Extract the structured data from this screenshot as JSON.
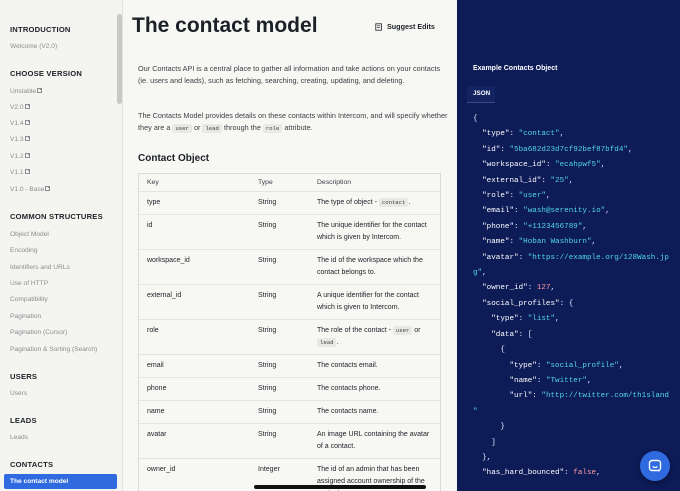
{
  "sidebar": {
    "sections": [
      {
        "title": "INTRODUCTION",
        "items": [
          {
            "label": "Welcome (V2.0)",
            "ext": false
          }
        ]
      },
      {
        "title": "CHOOSE VERSION",
        "items": [
          {
            "label": "Unstable",
            "ext": true
          },
          {
            "label": "V2.0",
            "ext": true
          },
          {
            "label": "V1.4",
            "ext": true
          },
          {
            "label": "V1.3",
            "ext": true
          },
          {
            "label": "V1.2",
            "ext": true
          },
          {
            "label": "V1.1",
            "ext": true
          },
          {
            "label": "V1.0 - Base",
            "ext": true
          }
        ]
      },
      {
        "title": "COMMON STRUCTURES",
        "items": [
          {
            "label": "Object Model",
            "ext": false
          },
          {
            "label": "Encoding",
            "ext": false
          },
          {
            "label": "Identifiers and URLs",
            "ext": false
          },
          {
            "label": "Use of HTTP",
            "ext": false
          },
          {
            "label": "Compatibility",
            "ext": false
          },
          {
            "label": "Pagination",
            "ext": false
          },
          {
            "label": "Pagination (Cursor)",
            "ext": false
          },
          {
            "label": "Pagination & Sorting (Search)",
            "ext": false
          }
        ]
      },
      {
        "title": "USERS",
        "items": [
          {
            "label": "Users",
            "ext": false
          }
        ]
      },
      {
        "title": "LEADS",
        "items": [
          {
            "label": "Leads",
            "ext": false
          }
        ]
      },
      {
        "title": "CONTACTS",
        "items": []
      }
    ],
    "active_item": "The contact model"
  },
  "main": {
    "title": "The contact model",
    "suggest_edits": "Suggest Edits",
    "intro": "Our Contacts API is a central place to gather all information and take actions on your contacts (ie. users and leads), such as fetching, searching, creating, updating, and deleting.",
    "para2_a": "The Contacts Model provides details on these contacts within Intercom, and will specify whether they are a",
    "para2_code1": "user",
    "para2_or": "or",
    "para2_code2": "lead",
    "para2_b": "through the",
    "para2_code3": "role",
    "para2_c": "attribute.",
    "object_title": "Contact Object",
    "table": {
      "headers": [
        "Key",
        "Type",
        "Description"
      ],
      "rows": [
        {
          "key": "type",
          "type": "String",
          "desc": "The type of object - ",
          "code": "contact",
          "desc_after": "."
        },
        {
          "key": "id",
          "type": "String",
          "desc": "The unique identifier for the contact which is given by Intercom."
        },
        {
          "key": "workspace_id",
          "type": "String",
          "desc": "The id of the workspace which the contact belongs to."
        },
        {
          "key": "external_id",
          "type": "String",
          "desc": "A unique identifier for the contact which is given to Intercom."
        },
        {
          "key": "role",
          "type": "String",
          "desc": "The role of the contact - ",
          "code": "user",
          "desc_mid": " or ",
          "code2": "lead",
          "desc_after": "."
        },
        {
          "key": "email",
          "type": "String",
          "desc": "The contacts email."
        },
        {
          "key": "phone",
          "type": "String",
          "desc": "The contacts phone."
        },
        {
          "key": "name",
          "type": "String",
          "desc": "The contacts name."
        },
        {
          "key": "avatar",
          "type": "String",
          "desc": "An image URL containing the avatar of a contact."
        },
        {
          "key": "owner_id",
          "type": "Integer",
          "desc": "The id of an admin that has been assigned account ownership of the contact."
        }
      ]
    }
  },
  "code_panel": {
    "title": "Example Contacts Object",
    "tab": "JSON",
    "lines": [
      [
        [
          "p",
          "{"
        ]
      ],
      [
        [
          "p",
          "  "
        ],
        [
          "k",
          "\"type\""
        ],
        [
          "p",
          ": "
        ],
        [
          "s",
          "\"contact\""
        ],
        [
          "p",
          ","
        ]
      ],
      [
        [
          "p",
          "  "
        ],
        [
          "k",
          "\"id\""
        ],
        [
          "p",
          ": "
        ],
        [
          "s",
          "\"5ba682d23d7cf92bef87bfd4\""
        ],
        [
          "p",
          ","
        ]
      ],
      [
        [
          "p",
          "  "
        ],
        [
          "k",
          "\"workspace_id\""
        ],
        [
          "p",
          ": "
        ],
        [
          "s",
          "\"ecahpwf5\""
        ],
        [
          "p",
          ","
        ]
      ],
      [
        [
          "p",
          "  "
        ],
        [
          "k",
          "\"external_id\""
        ],
        [
          "p",
          ": "
        ],
        [
          "s",
          "\"25\""
        ],
        [
          "p",
          ","
        ]
      ],
      [
        [
          "p",
          "  "
        ],
        [
          "k",
          "\"role\""
        ],
        [
          "p",
          ": "
        ],
        [
          "s",
          "\"user\""
        ],
        [
          "p",
          ","
        ]
      ],
      [
        [
          "p",
          "  "
        ],
        [
          "k",
          "\"email\""
        ],
        [
          "p",
          ": "
        ],
        [
          "s",
          "\"wash@serenity.io\""
        ],
        [
          "p",
          ","
        ]
      ],
      [
        [
          "p",
          "  "
        ],
        [
          "k",
          "\"phone\""
        ],
        [
          "p",
          ": "
        ],
        [
          "s",
          "\"+1123456789\""
        ],
        [
          "p",
          ","
        ]
      ],
      [
        [
          "p",
          "  "
        ],
        [
          "k",
          "\"name\""
        ],
        [
          "p",
          ": "
        ],
        [
          "s",
          "\"Hoban Washburn\""
        ],
        [
          "p",
          ","
        ]
      ],
      [
        [
          "p",
          "  "
        ],
        [
          "k",
          "\"avatar\""
        ],
        [
          "p",
          ": "
        ],
        [
          "s",
          "\"https://example.org/128Wash.jp"
        ]
      ],
      [
        [
          "s",
          "g\""
        ],
        [
          "p",
          ","
        ]
      ],
      [
        [
          "p",
          "  "
        ],
        [
          "k",
          "\"owner_id\""
        ],
        [
          "p",
          ": "
        ],
        [
          "n",
          "127"
        ],
        [
          "p",
          ","
        ]
      ],
      [
        [
          "p",
          "  "
        ],
        [
          "k",
          "\"social_profiles\""
        ],
        [
          "p",
          ": {"
        ]
      ],
      [
        [
          "p",
          "    "
        ],
        [
          "k",
          "\"type\""
        ],
        [
          "p",
          ": "
        ],
        [
          "s",
          "\"list\""
        ],
        [
          "p",
          ","
        ]
      ],
      [
        [
          "p",
          "    "
        ],
        [
          "k",
          "\"data\""
        ],
        [
          "p",
          ": ["
        ]
      ],
      [
        [
          "p",
          "      {"
        ]
      ],
      [
        [
          "p",
          "        "
        ],
        [
          "k",
          "\"type\""
        ],
        [
          "p",
          ": "
        ],
        [
          "s",
          "\"social_profile\""
        ],
        [
          "p",
          ","
        ]
      ],
      [
        [
          "p",
          "        "
        ],
        [
          "k",
          "\"name\""
        ],
        [
          "p",
          ": "
        ],
        [
          "s",
          "\"Twitter\""
        ],
        [
          "p",
          ","
        ]
      ],
      [
        [
          "p",
          "        "
        ],
        [
          "k",
          "\"url\""
        ],
        [
          "p",
          ": "
        ],
        [
          "s",
          "\"http://twitter.com/th1sland"
        ]
      ],
      [
        [
          "s",
          "\""
        ]
      ],
      [
        [
          "p",
          "      }"
        ]
      ],
      [
        [
          "p",
          "    ]"
        ]
      ],
      [
        [
          "p",
          "  },"
        ]
      ],
      [
        [
          "p",
          "  "
        ],
        [
          "k",
          "\"has_hard_bounced\""
        ],
        [
          "p",
          ": "
        ],
        [
          "b",
          "false"
        ],
        [
          "p",
          ","
        ]
      ]
    ]
  }
}
